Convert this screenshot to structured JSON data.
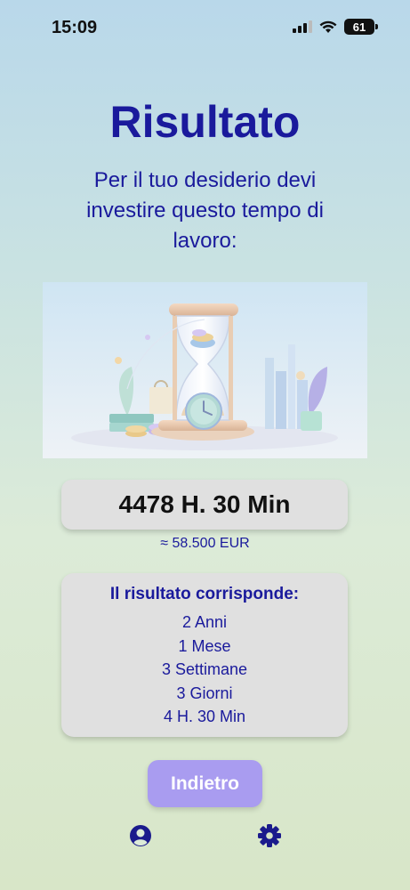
{
  "status_bar": {
    "time": "15:09",
    "battery": "61"
  },
  "page": {
    "title": "Risultato",
    "subtitle": "Per il tuo desiderio devi investire questo tempo di lavoro:"
  },
  "result": {
    "time_value": "4478 H. 30 Min",
    "approx_amount": "≈ 58.500 EUR"
  },
  "breakdown": {
    "title": "Il risultato corrisponde:",
    "items": [
      "2 Anni",
      "1 Mese",
      "3 Settimane",
      "3 Giorni",
      "4 H. 30 Min"
    ]
  },
  "actions": {
    "back_label": "Indietro"
  },
  "bottom_nav": {
    "icons": [
      "user-profile-icon",
      "gear-icon"
    ]
  },
  "colors": {
    "primary_text": "#1a1a9c",
    "button": "#a99cf0",
    "card": "#e0e0e0"
  }
}
